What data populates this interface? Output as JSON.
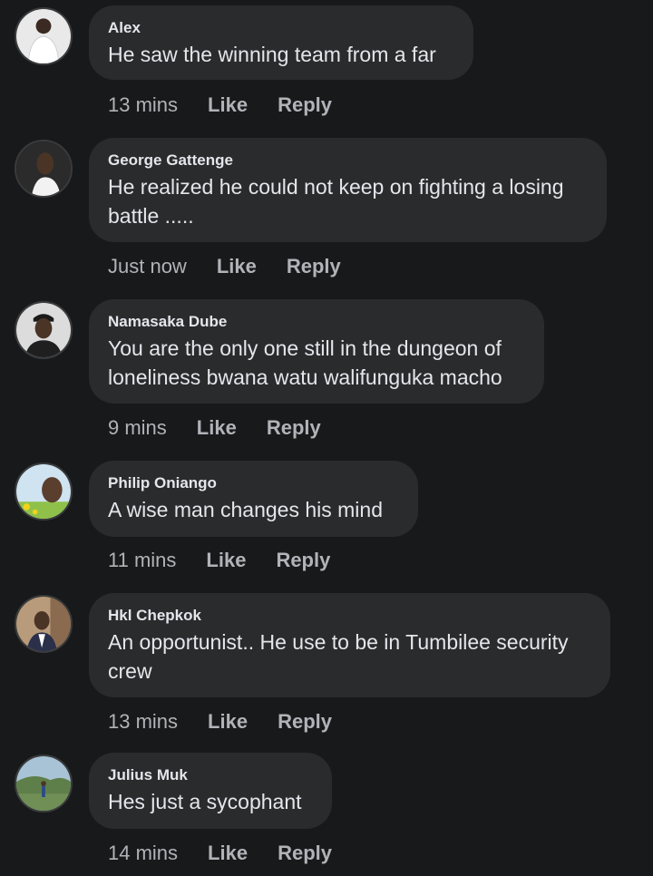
{
  "actions": {
    "like_label": "Like",
    "reply_label": "Reply"
  },
  "comments": [
    {
      "name": "Alex",
      "text": "He saw the winning team from a far",
      "time": "13 mins"
    },
    {
      "name": "George Gattenge",
      "text": "He realized he could not keep on fighting a losing battle .....",
      "time": "Just now"
    },
    {
      "name": "Namasaka Dube",
      "text": "You are the only one still in the dungeon of loneliness bwana watu walifunguka macho",
      "time": "9 mins"
    },
    {
      "name": "Philip Oniango",
      "text": "A wise man changes his mind",
      "time": "11 mins"
    },
    {
      "name": "Hkl Chepkok",
      "text": "An opportunist.. He use to be in Tumbilee security crew",
      "time": "13 mins"
    },
    {
      "name": "Julius Muk",
      "text": "Hes just a sycophant",
      "time": "14 mins"
    }
  ],
  "colors": {
    "background": "#18191a",
    "bubble": "#2a2b2d",
    "primary_text": "#e4e6eb",
    "secondary_text": "#b0b3b8"
  }
}
